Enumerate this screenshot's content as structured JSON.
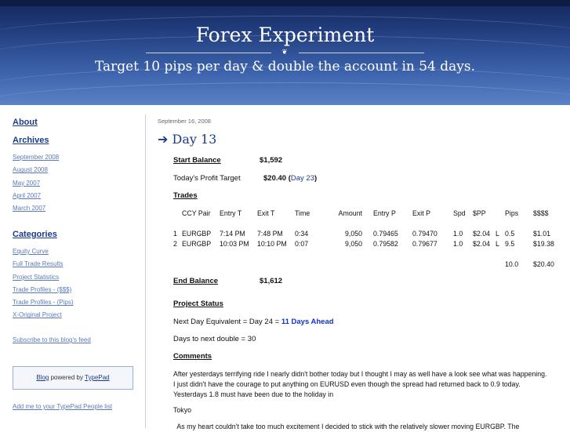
{
  "header": {
    "title": "Forex Experiment",
    "ornament": "❦",
    "subtitle": "Target 10 pips per day & double the account in 54 days."
  },
  "sidebar": {
    "about": "About",
    "archives": "Archives",
    "archive_links": [
      "September 2008",
      "August 2008",
      "May 2007",
      "April 2007",
      "March 2007"
    ],
    "categories": "Categories",
    "category_links": [
      "Equity Curve",
      "Full Trade Results",
      "Project Statistics",
      "Trade Profiles - ($$$)",
      "Trade Profiles - (Pips)",
      "X-Original Project"
    ],
    "subscribe": "Subscribe to this blog's feed",
    "typepad_blog": "Blog",
    "typepad_mid": " powered by ",
    "typepad_brand": "TypePad",
    "people_list": "Add me to your TypePad People list"
  },
  "post": {
    "date": "September 16, 2008",
    "arrow": "➔",
    "title": "Day 13",
    "start_balance_label": "Start Balance",
    "start_balance_value": "$1,592",
    "profit_target_label": "Today's Profit Target",
    "profit_target_value": "$20.40",
    "profit_target_open": " (",
    "profit_target_link": "Day 23",
    "profit_target_close": ")",
    "trades_label": "Trades",
    "columns": [
      "CCY Pair",
      "Entry T",
      "Exit T",
      "Time",
      "Amount",
      "Entry P",
      "Exit P",
      "Spd",
      "$PP",
      "",
      "Pips",
      "$$$$"
    ],
    "rows": [
      [
        "1",
        "EURGBP",
        "7:14 PM",
        "7:48 PM",
        "0:34",
        "9,050",
        "0.79465",
        "0.79470",
        "1.0",
        "$2.04",
        "L",
        "0.5",
        "$1.01"
      ],
      [
        "2",
        "EURGBP",
        "10:03 PM",
        "10:10 PM",
        "0:07",
        "9,050",
        "0.79582",
        "0.79677",
        "1.0",
        "$2.04",
        "L",
        "9.5",
        "$19.38"
      ]
    ],
    "total_pips": "10.0",
    "total_amount": "$20.40",
    "end_balance_label": "End Balance",
    "end_balance_value": "$1,612",
    "project_status_label": "Project Status",
    "next_day_text": "Next Day Equivalent = Day 24 = ",
    "next_day_ahead": "11 Days Ahead",
    "days_to_double": "Days to next double = 30",
    "comments_label": "Comments",
    "comment_1": "After yesterdays terrifying ride I nearly didn't bother today but I thought I may as well have a look see what was happening. I just didn't have the courage to put anything on EURUSD even though the spread had returned back to 0.9 today. Yesterdays 1.8 must have been due to the holiday in",
    "comment_2": "Tokyo",
    "comment_3": "  As my heart couldn't take too much excitement I decided to stick with the relatively slower moving EURGBP. The"
  }
}
